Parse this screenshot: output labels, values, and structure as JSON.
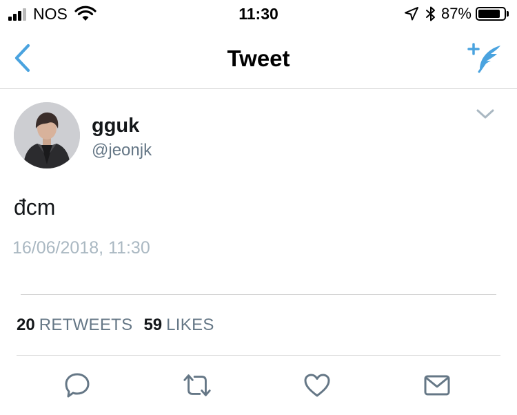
{
  "status_bar": {
    "carrier": "NOS",
    "time": "11:30",
    "battery_percent": "87%",
    "battery_level": 0.87,
    "signal_bars_active": 3,
    "signal_bars_total": 4
  },
  "nav": {
    "title": "Tweet",
    "back_icon": "chevron-left-icon",
    "compose_icon": "compose-tweet-icon"
  },
  "tweet": {
    "display_name": "gguk",
    "handle": "@jeonjk",
    "text": "đcm",
    "timestamp": "16/06/2018, 11:30"
  },
  "stats": {
    "retweets_count": "20",
    "retweets_label": "RETWEETS",
    "likes_count": "59",
    "likes_label": "LIKES"
  },
  "actions": [
    "reply-icon",
    "retweet-icon",
    "like-icon",
    "message-icon"
  ],
  "colors": {
    "accent": "#4aa3df",
    "icon_gray": "#657786",
    "timestamp_gray": "#aab8c2",
    "divider": "#d6d6d6"
  }
}
